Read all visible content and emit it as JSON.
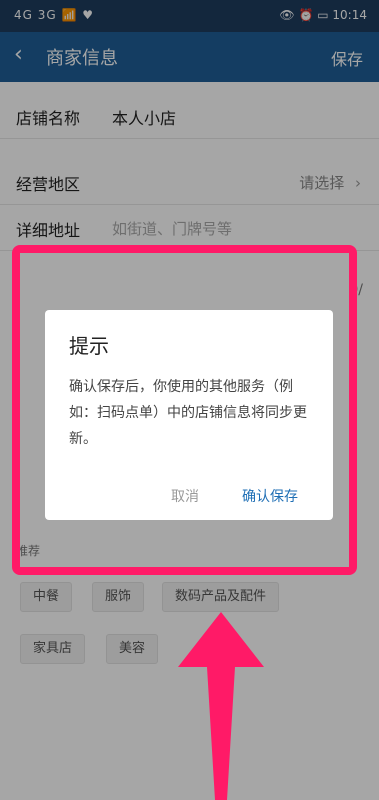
{
  "status_bar": {
    "left_signals": "4G 3G 📶 ♥",
    "right_icons": "👁 ⏰ ▭",
    "time": "10:14"
  },
  "nav": {
    "title": "商家信息",
    "save": "保存"
  },
  "form": {
    "shop_name_label": "店铺名称",
    "shop_name_value": "本人小店",
    "region_label": "经营地区",
    "region_select": "请选择",
    "address_label": "详细地址",
    "address_placeholder": "如街道、门牌号等",
    "counter_text": "0/",
    "tags_hint": "推荐",
    "tags": [
      "中餐",
      "服饰",
      "数码产品及配件",
      "家具店",
      "美容"
    ]
  },
  "dialog": {
    "title": "提示",
    "message": "确认保存后，你使用的其他服务（例如：扫码点单）中的店铺信息将同步更新。",
    "cancel": "取消",
    "confirm": "确认保存"
  },
  "colors": {
    "nav_bg": "#1f5f97",
    "highlight": "#ff1a67",
    "accent": "#1f6fb5"
  }
}
